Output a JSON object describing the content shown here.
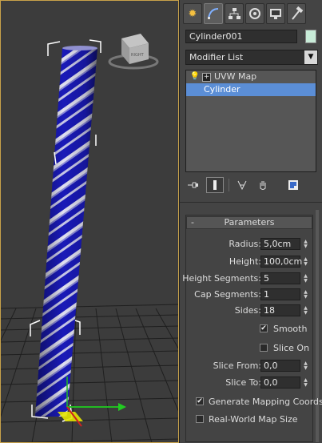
{
  "viewport": {
    "viewcube_label": "RIGHT",
    "object_color_stripe": "#e0e0f0",
    "object_color_base": "#1a1ab8",
    "selection_bracket_color": "#ffffff",
    "frame_color": "#c8a24a"
  },
  "panel": {
    "tabs": [
      {
        "name": "create-tab",
        "icon": "sun-icon"
      },
      {
        "name": "modify-tab",
        "icon": "curve-icon"
      },
      {
        "name": "hierarchy-tab",
        "icon": "hierarchy-icon"
      },
      {
        "name": "motion-tab",
        "icon": "motion-icon"
      },
      {
        "name": "display-tab",
        "icon": "monitor-icon"
      },
      {
        "name": "utilities-tab",
        "icon": "hammer-icon"
      }
    ],
    "object_name": "Cylinder001",
    "object_color": "#c8ecd8",
    "modifier_list_label": "Modifier List",
    "stack": [
      {
        "label": "UVW Map",
        "selected": false
      },
      {
        "label": "Cylinder",
        "selected": true
      }
    ],
    "tool_icons": [
      "pin-stack-icon",
      "show-end-result-icon",
      "make-unique-icon",
      "remove-modifier-icon",
      "configure-sets-icon"
    ]
  },
  "parameters": {
    "collapse": "-",
    "title": "Parameters",
    "radius_label": "Radius:",
    "radius_value": "5,0cm",
    "height_label": "Height:",
    "height_value": "100,0cm",
    "height_segments_label": "Height Segments:",
    "height_segments_value": "5",
    "cap_segments_label": "Cap Segments:",
    "cap_segments_value": "1",
    "sides_label": "Sides:",
    "sides_value": "18",
    "smooth_label": "Smooth",
    "smooth_checked": true,
    "slice_on_label": "Slice On",
    "slice_on_checked": false,
    "slice_from_label": "Slice From:",
    "slice_from_value": "0,0",
    "slice_to_label": "Slice To:",
    "slice_to_value": "0,0",
    "gen_mapping_label": "Generate Mapping Coords.",
    "gen_mapping_checked": true,
    "real_world_label": "Real-World Map Size",
    "real_world_checked": false
  }
}
